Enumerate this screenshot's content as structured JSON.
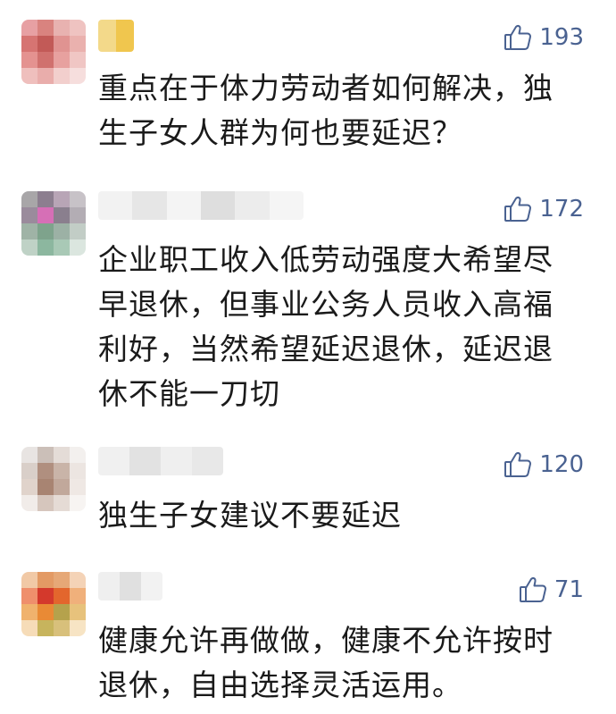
{
  "accent_color": "#4a6291",
  "comments": [
    {
      "likes": "193",
      "text": "重点在于体力劳动者如何解决，独生子女人群为何也要延迟？"
    },
    {
      "likes": "172",
      "text": "企业职工收入低劳动强度大希望尽早退休，但事业公务人员收入高福利好，当然希望延迟退休，延迟退休不能一刀切"
    },
    {
      "likes": "120",
      "text": "独生子女建议不要延迟"
    },
    {
      "likes": "71",
      "text": "健康允许再做做，健康不允许按时退休，自由选择灵活运用。"
    }
  ]
}
